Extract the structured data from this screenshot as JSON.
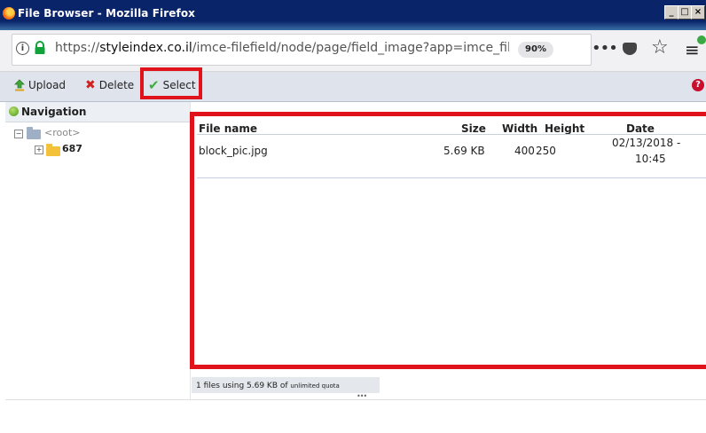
{
  "window": {
    "title": "File Browser - Mozilla Firefox",
    "controls": [
      "_",
      "□",
      "×"
    ]
  },
  "address_bar": {
    "url_prefix": "https://",
    "url_domain": "styleindex.co.il",
    "url_path": "/imce-filefield/node/page/field_image?app=imce_filefi",
    "zoom": "90%",
    "more_icon": "•••"
  },
  "toolbar": {
    "upload_label": "Upload",
    "delete_label": "Delete",
    "select_label": "Select",
    "help_icon": "?"
  },
  "navigation": {
    "title": "Navigation",
    "root_label": "<root>",
    "folder_label": "687",
    "toggle_open": "−",
    "toggle_closed": "+"
  },
  "file_list": {
    "columns": [
      "File name",
      "Size",
      "Width",
      "Height",
      "Date"
    ],
    "rows": [
      {
        "name": "block_pic.jpg",
        "size": "5.69 KB",
        "width": "400",
        "height": "250",
        "date_line1": "02/13/2018 -",
        "date_line2": "10:45"
      }
    ]
  },
  "status": {
    "prefix": "1 files using 5.69 KB of ",
    "quota": "unlimited quota",
    "grip": "•••"
  },
  "colors": {
    "highlight": "#e0121b",
    "titlebar": "#0a246a",
    "toolbar": "#dfe4ec"
  }
}
